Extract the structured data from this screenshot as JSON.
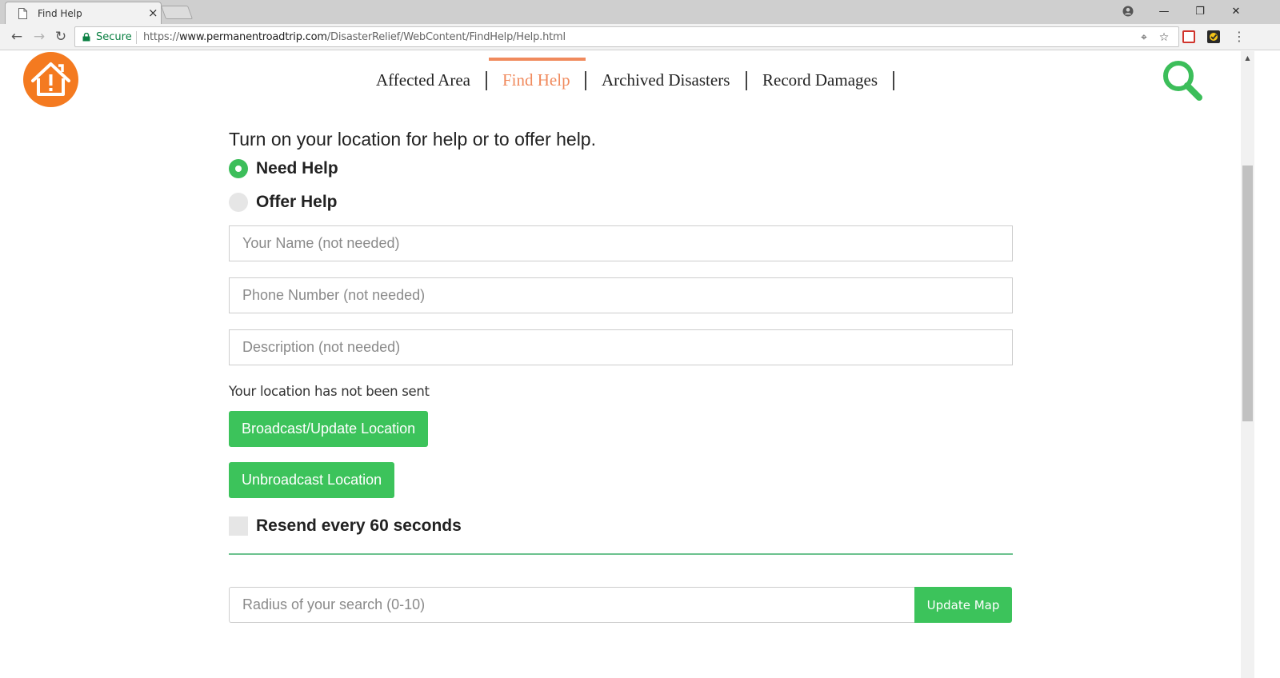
{
  "browser": {
    "tab_title": "Find Help",
    "tab_close": "×",
    "secure_label": "Secure",
    "url_scheme": "https://",
    "url_host": "www.permanentroadtrip.com",
    "url_path": "/DisasterRelief/WebContent/FindHelp/Help.html",
    "menu_dots": "⋮",
    "window_controls": [
      "—",
      "❐",
      "✕"
    ],
    "nav_back": "←",
    "nav_forward": "→",
    "nav_reload": "↻",
    "location_icon": "⌖",
    "star_icon": "☆"
  },
  "header": {
    "nav_items": [
      {
        "label": "Affected Area",
        "active": false
      },
      {
        "label": "Find Help",
        "active": true
      },
      {
        "label": "Archived Disasters",
        "active": false
      },
      {
        "label": "Record Damages",
        "active": false
      }
    ],
    "accent_color": "#f08a5d",
    "logo_color": "#f47a20",
    "search_icon": "search-icon"
  },
  "form": {
    "prompt": "Turn on your location for help or to offer help.",
    "radios": [
      {
        "label": "Need Help",
        "checked": true
      },
      {
        "label": "Offer Help",
        "checked": false
      }
    ],
    "name_placeholder": "Your Name (not needed)",
    "phone_placeholder": "Phone Number (not needed)",
    "description_placeholder": "Description (not needed)",
    "status": "Your location has not been sent",
    "broadcast_label": "Broadcast/Update Location",
    "unbroadcast_label": "Unbroadcast Location",
    "resend_label": "Resend every 60 seconds",
    "resend_checked": false,
    "radius_placeholder": "Radius of your search (0-10)",
    "update_map_label": "Update Map",
    "button_color": "#3cc35b"
  }
}
